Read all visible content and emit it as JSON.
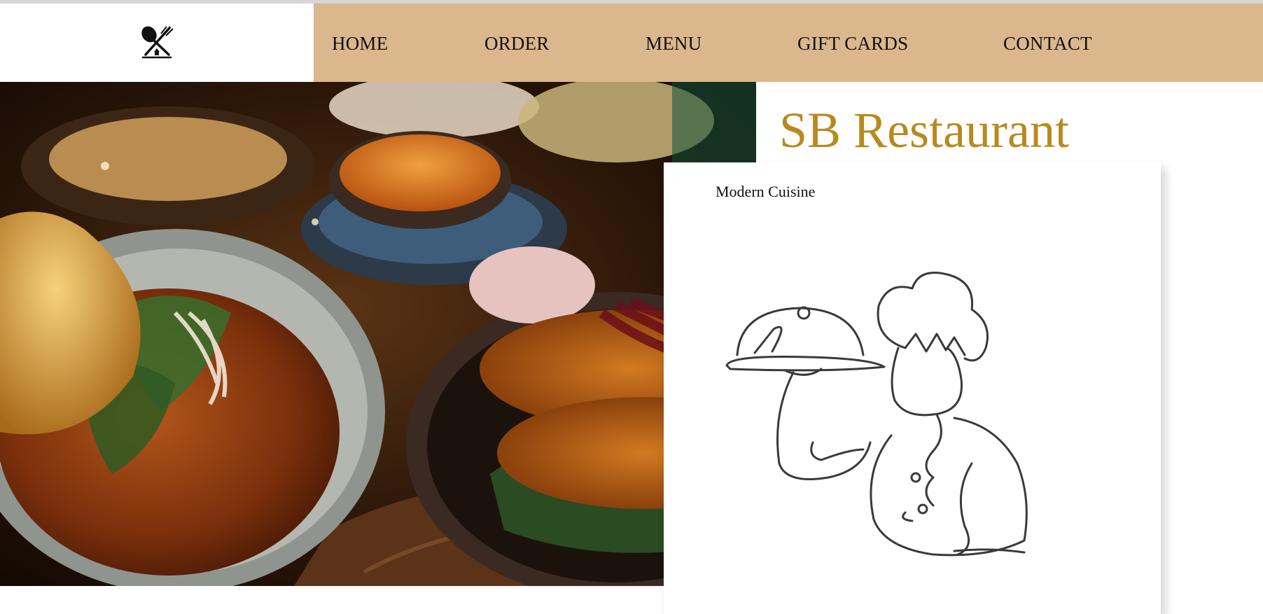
{
  "header": {
    "logo_icon": "crossed-spoon-fork-logo-icon",
    "nav": [
      {
        "label": "HOME"
      },
      {
        "label": "ORDER"
      },
      {
        "label": "MENU"
      },
      {
        "label": "GIFT CARDS"
      },
      {
        "label": "CONTACT"
      }
    ],
    "nav_background": "#dbb78d"
  },
  "hero": {
    "title": "SB Restaurant",
    "title_color": "#b8891e",
    "photo": "food-table-photo"
  },
  "card": {
    "caption": "Modern Cuisine",
    "illustration": "chef-line-art-illustration"
  }
}
